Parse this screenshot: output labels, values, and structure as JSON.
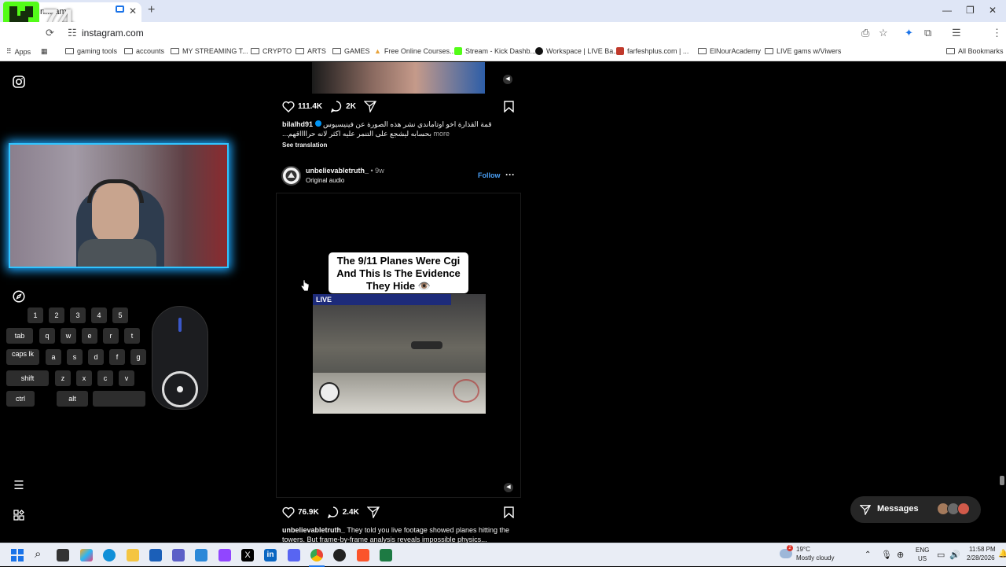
{
  "browser": {
    "tab_title": "In... am",
    "url": "instagram.com",
    "bookmarks": [
      "Apps",
      "gaming tools",
      "accounts",
      "MY STREAMING T...",
      "CRYPTO",
      "ARTS",
      "GAMES",
      "Free Online Courses...",
      "Stream - Kick Dashb...",
      "Workspace | LIVE Ba...",
      "farfeshplus.com | ...",
      "ElNourAcademy",
      "LIVE gams w/Viwers"
    ],
    "all_bookmarks": "All Bookmarks"
  },
  "overlay": {
    "channel_badge": "74",
    "keys_row1": [
      "1",
      "2",
      "3",
      "4",
      "5"
    ],
    "keys_row2": [
      "tab",
      "q",
      "w",
      "e",
      "r",
      "t"
    ],
    "keys_row3": [
      "caps lk",
      "a",
      "s",
      "d",
      "f",
      "g"
    ],
    "keys_row4": [
      "shift",
      "z",
      "x",
      "c",
      "v"
    ],
    "keys_row5": [
      "ctrl",
      "alt"
    ]
  },
  "post1": {
    "likes": "111.4K",
    "comments": "2K",
    "username": "bilalhd91",
    "caption": "قمة القذارة اخو اوتاماندي نشر هذه الصورة عن فينيسيوس بحسابه ليشجع على التنمر عليه اكثر لانه حرااااقهم...",
    "more": "more",
    "see_translation": "See translation"
  },
  "post2": {
    "username": "unbelievabletruth_",
    "time": "• 9w",
    "audio": "Original audio",
    "follow": "Follow",
    "video_title": "The 9/11 Planes Were Cgi And This Is The Evidence They Hide 👁️",
    "live_tag": "LIVE",
    "likes": "76.9K",
    "comments": "2.4K",
    "caption_user": "unbelievabletruth_",
    "caption": "They told you live footage showed planes hitting the towers. But frame-by-frame analysis reveals impossible physics..."
  },
  "messages": {
    "label": "Messages"
  },
  "taskbar": {
    "weather_temp": "19°C",
    "weather_desc": "Mostly cloudy",
    "weather_badge": "2",
    "lang_top": "ENG",
    "lang_bottom": "US",
    "time": "11:58 PM",
    "date": "2/28/2026"
  }
}
